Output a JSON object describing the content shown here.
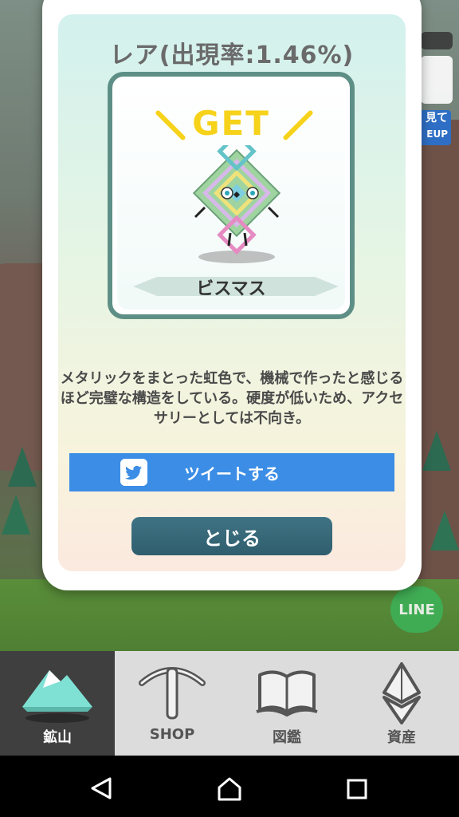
{
  "modal": {
    "rarity_title": "レア(出現率:1.46%)",
    "get_label": "GET",
    "character_name": "ビスマス",
    "description": "メタリックをまとった虹色で、機械で作ったと感じるほど完璧な構造をしている。硬度が低いため、アクセサリーとしては不向き。",
    "tweet_label": "ツイートする",
    "close_label": "とじる"
  },
  "background": {
    "side_button_fragment_1": "見て",
    "side_button_fragment_2": "EUP",
    "line_badge": "LINE"
  },
  "bottom_nav": {
    "items": [
      {
        "label": "鉱山",
        "icon": "mountain-icon",
        "active": true
      },
      {
        "label": "SHOP",
        "icon": "pickaxe-icon",
        "active": false
      },
      {
        "label": "図鑑",
        "icon": "book-icon",
        "active": false
      },
      {
        "label": "資産",
        "icon": "ethereum-icon",
        "active": false
      }
    ]
  },
  "system_nav": {
    "icons": [
      "back-icon",
      "home-icon",
      "recents-icon"
    ]
  },
  "colors": {
    "get_yellow": "#f6d21a",
    "card_border": "#5e8f86",
    "tweet_blue": "#3b8de5",
    "close_teal": "#2f5e6e",
    "nav_active": "#3f3f3f",
    "nav_bg": "#dcdcdc"
  }
}
